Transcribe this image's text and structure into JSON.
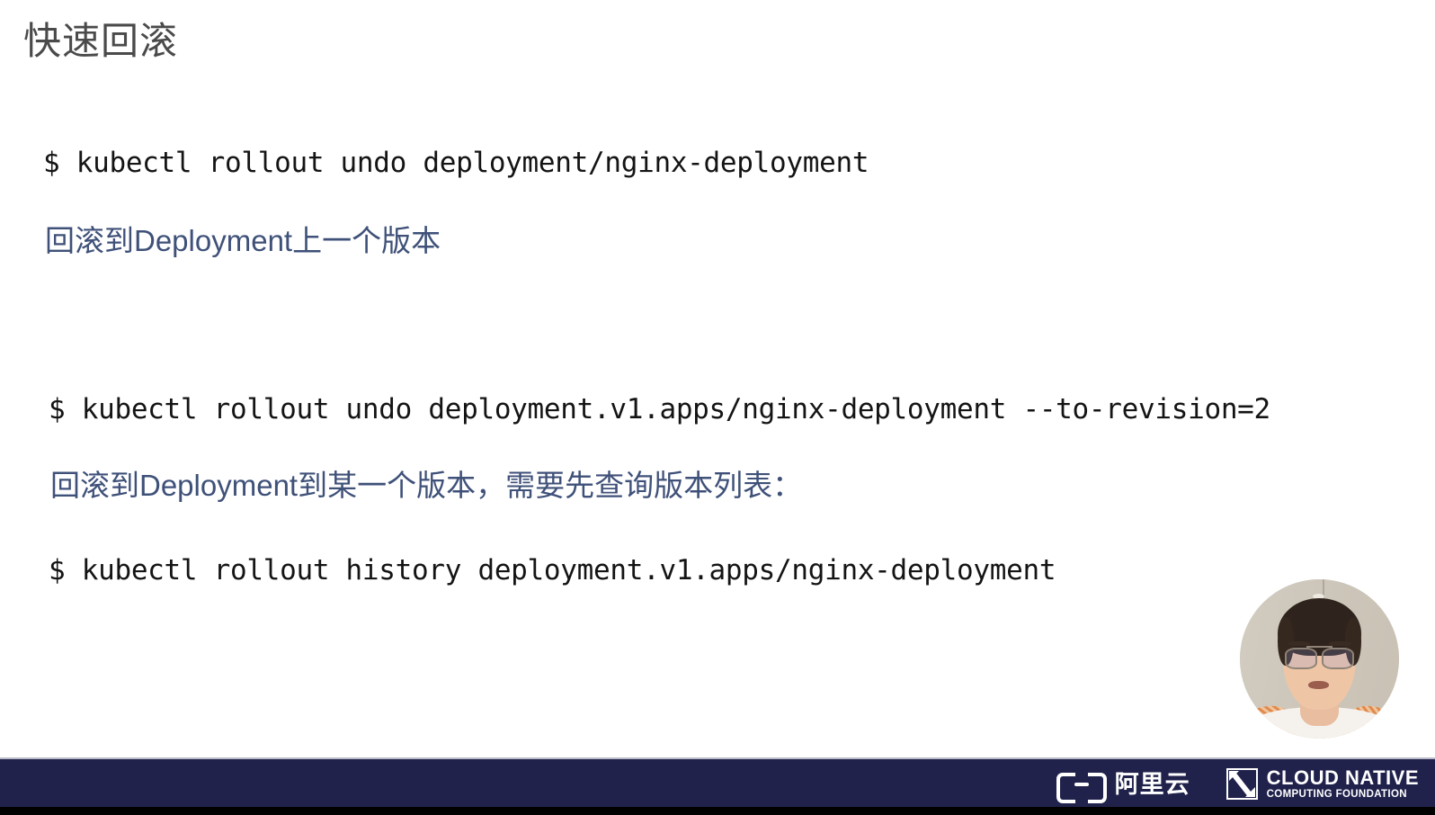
{
  "slide": {
    "title": "快速回滚",
    "title_color": "#4a4a4a",
    "background_color": "#ffffff"
  },
  "content": {
    "code_accent_color": "#141414",
    "note_accent_color": "#3f5179",
    "blocks": [
      {
        "command": "$ kubectl rollout undo deployment/nginx-deployment",
        "note": "回滚到Deployment上一个版本"
      },
      {
        "command": "$ kubectl rollout undo deployment.v1.apps/nginx-deployment --to-revision=2",
        "note": "回滚到Deployment到某一个版本，需要先查询版本列表："
      },
      {
        "command": "$ kubectl rollout history deployment.v1.apps/nginx-deployment",
        "note": ""
      }
    ]
  },
  "webcam": {
    "label": "presenter-video-bubble"
  },
  "footer": {
    "background_color": "#20224c",
    "alibaba": {
      "name": "阿里云"
    },
    "cncf": {
      "line1": "CLOUD NATIVE",
      "line2": "COMPUTING FOUNDATION"
    }
  }
}
